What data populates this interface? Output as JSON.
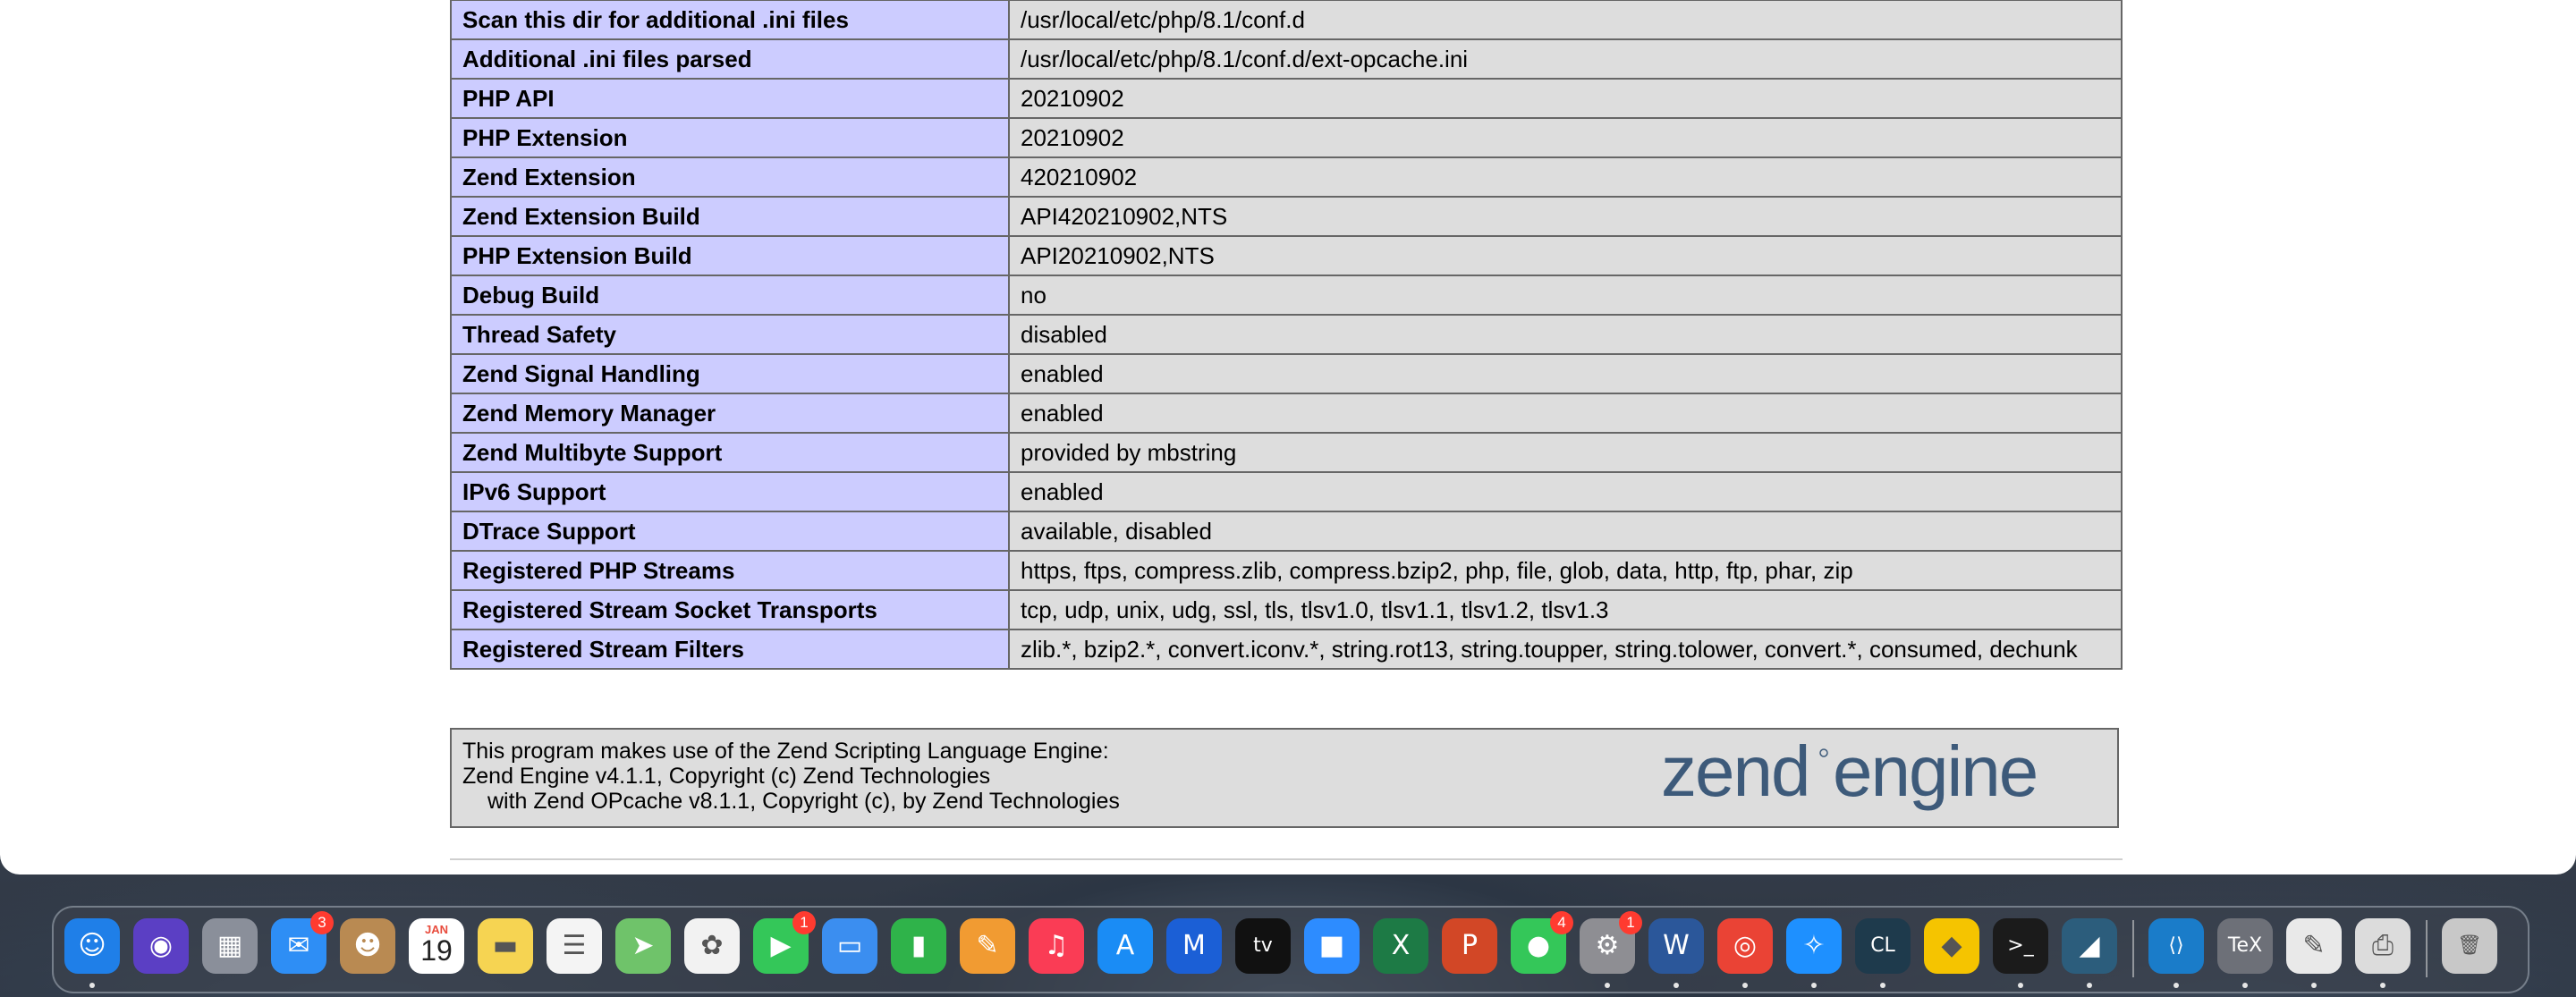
{
  "info_rows": [
    {
      "label": "Scan this dir for additional .ini files",
      "value": "/usr/local/etc/php/8.1/conf.d"
    },
    {
      "label": "Additional .ini files parsed",
      "value": "/usr/local/etc/php/8.1/conf.d/ext-opcache.ini"
    },
    {
      "label": "PHP API",
      "value": "20210902"
    },
    {
      "label": "PHP Extension",
      "value": "20210902"
    },
    {
      "label": "Zend Extension",
      "value": "420210902"
    },
    {
      "label": "Zend Extension Build",
      "value": "API420210902,NTS"
    },
    {
      "label": "PHP Extension Build",
      "value": "API20210902,NTS"
    },
    {
      "label": "Debug Build",
      "value": "no"
    },
    {
      "label": "Thread Safety",
      "value": "disabled"
    },
    {
      "label": "Zend Signal Handling",
      "value": "enabled"
    },
    {
      "label": "Zend Memory Manager",
      "value": "enabled"
    },
    {
      "label": "Zend Multibyte Support",
      "value": "provided by mbstring"
    },
    {
      "label": "IPv6 Support",
      "value": "enabled"
    },
    {
      "label": "DTrace Support",
      "value": "available, disabled"
    },
    {
      "label": "Registered PHP Streams",
      "value": "https, ftps, compress.zlib, compress.bzip2, php, file, glob, data, http, ftp, phar, zip"
    },
    {
      "label": "Registered Stream Socket Transports",
      "value": "tcp, udp, unix, udg, ssl, tls, tlsv1.0, tlsv1.1, tlsv1.2, tlsv1.3"
    },
    {
      "label": "Registered Stream Filters",
      "value": "zlib.*, bzip2.*, convert.iconv.*, string.rot13, string.toupper, string.tolower, convert.*, consumed, dechunk"
    }
  ],
  "credits": {
    "line1": "This program makes use of the Zend Scripting Language Engine:",
    "line2": "Zend Engine v4.1.1, Copyright (c) Zend Technologies",
    "line3": "with Zend OPcache v8.1.1, Copyright (c), by Zend Technologies",
    "logo_text": "zend engine",
    "logo_color": "#3d5a7a"
  },
  "dock": {
    "calendar": {
      "month": "JAN",
      "day": "19"
    },
    "badges": {
      "mail": "3",
      "facetime": "1",
      "messages": "4",
      "settings": "1"
    },
    "apps": [
      {
        "name": "finder-icon",
        "color": "#1f7fe8",
        "glyph": "☺"
      },
      {
        "name": "siri-icon",
        "color": "#5b3fc4",
        "glyph": "◉"
      },
      {
        "name": "launchpad-icon",
        "color": "#8a8f9a",
        "glyph": "▦"
      },
      {
        "name": "mail-icon",
        "color": "#2e8ef5",
        "glyph": "✉"
      },
      {
        "name": "contacts-icon",
        "color": "#b98a52",
        "glyph": "☻"
      },
      {
        "name": "calendar-icon",
        "color": "#ffffff",
        "glyph": ""
      },
      {
        "name": "notes-icon",
        "color": "#f6d452",
        "glyph": "▬"
      },
      {
        "name": "reminders-icon",
        "color": "#f4f4f4",
        "glyph": "☰"
      },
      {
        "name": "maps-icon",
        "color": "#6fc36a",
        "glyph": "➤"
      },
      {
        "name": "photos-icon",
        "color": "#f2f2f2",
        "glyph": "✿"
      },
      {
        "name": "facetime-icon",
        "color": "#34c759",
        "glyph": "▶"
      },
      {
        "name": "keynote-icon",
        "color": "#3b8ef0",
        "glyph": "▭"
      },
      {
        "name": "numbers-icon",
        "color": "#2fb34a",
        "glyph": "▮"
      },
      {
        "name": "pages-icon",
        "color": "#f19b32",
        "glyph": "✎"
      },
      {
        "name": "music-icon",
        "color": "#fa3c55",
        "glyph": "♫"
      },
      {
        "name": "app-store-icon",
        "color": "#1a8cf5",
        "glyph": "A"
      },
      {
        "name": "vpn-icon",
        "color": "#1b5fd6",
        "glyph": "M"
      },
      {
        "name": "apple-tv-icon",
        "color": "#111111",
        "glyph": "tv"
      },
      {
        "name": "zoom-icon",
        "color": "#2d8cff",
        "glyph": "■"
      },
      {
        "name": "excel-icon",
        "color": "#1d7a45",
        "glyph": "X"
      },
      {
        "name": "powerpoint-icon",
        "color": "#d24726",
        "glyph": "P"
      },
      {
        "name": "messages-icon",
        "color": "#34c759",
        "glyph": "●"
      },
      {
        "name": "system-settings-icon",
        "color": "#8e8e93",
        "glyph": "⚙"
      },
      {
        "name": "word-icon",
        "color": "#2b579a",
        "glyph": "W"
      },
      {
        "name": "chrome-icon",
        "color": "#ea4335",
        "glyph": "◎"
      },
      {
        "name": "safari-icon",
        "color": "#1e90ff",
        "glyph": "✧"
      },
      {
        "name": "clion-icon",
        "color": "#1e3a4c",
        "glyph": "CL"
      },
      {
        "name": "cyberduck-icon",
        "color": "#f5c400",
        "glyph": "◆"
      },
      {
        "name": "terminal-icon",
        "color": "#1b1b1b",
        "glyph": ">_"
      },
      {
        "name": "mysql-workbench-icon",
        "color": "#2c5d7c",
        "glyph": "◢"
      },
      {
        "name": "vscode-icon",
        "color": "#1a7cc9",
        "glyph": "⟨⟩"
      },
      {
        "name": "tex-icon",
        "color": "#6d7078",
        "glyph": "TeX"
      },
      {
        "name": "textedit-icon",
        "color": "#e9e9e9",
        "glyph": "✎"
      },
      {
        "name": "printer-icon",
        "color": "#dcdcdc",
        "glyph": "⎙"
      },
      {
        "name": "trash-icon",
        "color": "#c8c8c8",
        "glyph": "🗑"
      }
    ]
  }
}
